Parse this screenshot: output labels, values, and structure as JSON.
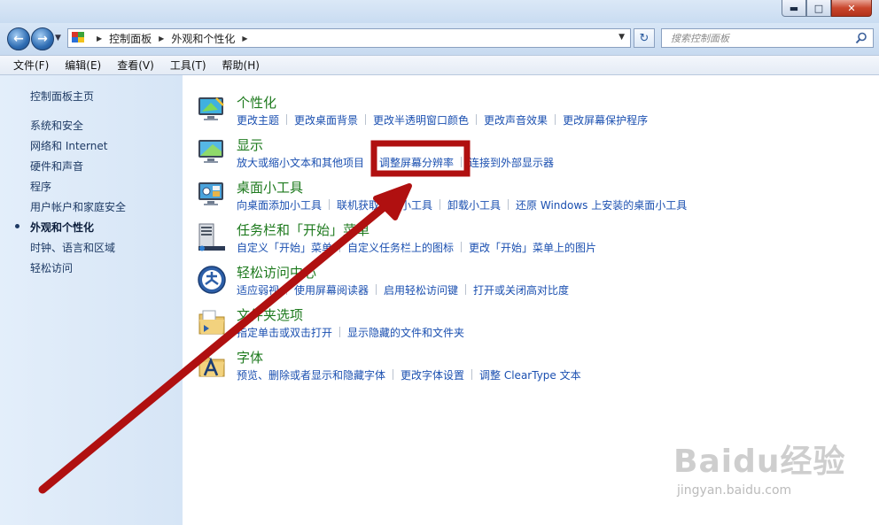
{
  "address": {
    "crumbs": [
      "控制面板",
      "外观和个性化"
    ]
  },
  "search": {
    "placeholder": "搜索控制面板"
  },
  "menu": [
    "文件(F)",
    "编辑(E)",
    "查看(V)",
    "工具(T)",
    "帮助(H)"
  ],
  "sidebar": {
    "home": "控制面板主页",
    "items": [
      "系统和安全",
      "网络和 Internet",
      "硬件和声音",
      "程序",
      "用户帐户和家庭安全",
      "外观和个性化",
      "时钟、语言和区域",
      "轻松访问"
    ],
    "current_index": 5
  },
  "categories": [
    {
      "title": "个性化",
      "icon": "personalization-icon",
      "links": [
        "更改主题",
        "更改桌面背景",
        "更改半透明窗口颜色",
        "更改声音效果",
        "更改屏幕保护程序"
      ]
    },
    {
      "title": "显示",
      "icon": "display-icon",
      "links": [
        "放大或缩小文本和其他项目",
        "调整屏幕分辨率",
        "连接到外部显示器"
      ]
    },
    {
      "title": "桌面小工具",
      "icon": "gadgets-icon",
      "links": [
        "向桌面添加小工具",
        "联机获取更多小工具",
        "卸载小工具",
        "还原 Windows 上安装的桌面小工具"
      ]
    },
    {
      "title": "任务栏和「开始」菜单",
      "icon": "taskbar-icon",
      "links": [
        "自定义「开始」菜单",
        "自定义任务栏上的图标",
        "更改「开始」菜单上的图片"
      ]
    },
    {
      "title": "轻松访问中心",
      "icon": "ease-of-access-icon",
      "links": [
        "适应弱视",
        "使用屏幕阅读器",
        "启用轻松访问键",
        "打开或关闭高对比度"
      ]
    },
    {
      "title": "文件夹选项",
      "icon": "folder-options-icon",
      "links": [
        "指定单击或双击打开",
        "显示隐藏的文件和文件夹"
      ]
    },
    {
      "title": "字体",
      "icon": "fonts-icon",
      "links": [
        "预览、删除或者显示和隐藏字体",
        "更改字体设置",
        "调整 ClearType 文本"
      ]
    }
  ],
  "annotation": {
    "highlight_color": "#b01010"
  },
  "watermark": {
    "brand": "Baidu经验",
    "url": "jingyan.baidu.com"
  }
}
